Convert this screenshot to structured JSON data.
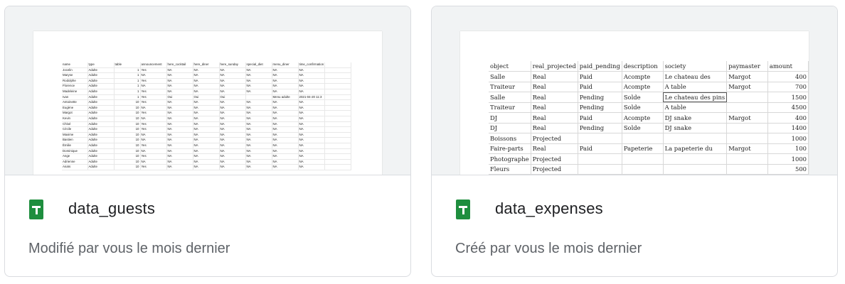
{
  "files": [
    {
      "name": "data_guests",
      "meta": "Modifié par vous le mois dernier",
      "icon": "google-sheets-icon",
      "sheet": {
        "headers": [
          "name",
          "type",
          "table",
          "announcement",
          "here_cocktail",
          "here_diner",
          "here_sunday",
          "special_diet",
          "menu_diner",
          "time_confirmation"
        ],
        "rows": [
          [
            "Jocelin",
            "Adulte",
            "1",
            "Yes",
            "NA",
            "NA",
            "NA",
            "NA",
            "NA",
            "NA"
          ],
          [
            "Maryse",
            "Adulte",
            "1",
            "NA",
            "NA",
            "NA",
            "NA",
            "NA",
            "NA",
            "NA"
          ],
          [
            "Rodolphe",
            "Adulte",
            "1",
            "Yes",
            "NA",
            "NA",
            "NA",
            "NA",
            "NA",
            "NA"
          ],
          [
            "Florence",
            "Adulte",
            "1",
            "NA",
            "NA",
            "NA",
            "NA",
            "NA",
            "NA",
            "NA"
          ],
          [
            "Madeleine",
            "Adulte",
            "1",
            "Yes",
            "NA",
            "NA",
            "NA",
            "NA",
            "NA",
            "NA"
          ],
          [
            "Ivan",
            "Adulte",
            "1",
            "Yes",
            "Oui",
            "Oui",
            "Oui",
            "",
            "Menu adulte",
            "2021-04-20 11:3"
          ],
          [
            "Antoinette",
            "Adulte",
            "10",
            "Yes",
            "NA",
            "NA",
            "NA",
            "NA",
            "NA",
            "NA"
          ],
          [
            "Eugène",
            "Adulte",
            "10",
            "NA",
            "NA",
            "NA",
            "NA",
            "NA",
            "NA",
            "NA"
          ],
          [
            "Margot",
            "Adulte",
            "10",
            "Yes",
            "NA",
            "NA",
            "NA",
            "NA",
            "NA",
            "NA"
          ],
          [
            "Kevin",
            "Adulte",
            "10",
            "NA",
            "NA",
            "NA",
            "NA",
            "NA",
            "NA",
            "NA"
          ],
          [
            "Chloé",
            "Adulte",
            "10",
            "Yes",
            "NA",
            "NA",
            "NA",
            "NA",
            "NA",
            "NA"
          ],
          [
            "Cécile",
            "Adulte",
            "10",
            "Yes",
            "NA",
            "NA",
            "NA",
            "NA",
            "NA",
            "NA"
          ],
          [
            "Maxime",
            "Adulte",
            "10",
            "NA",
            "NA",
            "NA",
            "NA",
            "NA",
            "NA",
            "NA"
          ],
          [
            "Bastien",
            "Adulte",
            "10",
            "NA",
            "NA",
            "NA",
            "NA",
            "NA",
            "NA",
            "NA"
          ],
          [
            "Émilie",
            "Adulte",
            "10",
            "Yes",
            "NA",
            "NA",
            "NA",
            "NA",
            "NA",
            "NA"
          ],
          [
            "Dominique",
            "Adulte",
            "10",
            "NA",
            "NA",
            "NA",
            "NA",
            "NA",
            "NA",
            "NA"
          ],
          [
            "Ange",
            "Adulte",
            "10",
            "Yes",
            "NA",
            "NA",
            "NA",
            "NA",
            "NA",
            "NA"
          ],
          [
            "Adrienne",
            "Adulte",
            "10",
            "NA",
            "NA",
            "NA",
            "NA",
            "NA",
            "NA",
            "NA"
          ],
          [
            "Anaïs",
            "Adulte",
            "10",
            "Yes",
            "NA",
            "NA",
            "NA",
            "NA",
            "NA",
            "NA"
          ]
        ]
      }
    },
    {
      "name": "data_expenses",
      "meta": "Créé par vous le mois dernier",
      "icon": "google-sheets-icon",
      "sheet": {
        "headers": [
          "object",
          "real_projected",
          "paid_pending",
          "description",
          "society",
          "paymaster",
          "amount"
        ],
        "rows": [
          [
            "Salle",
            "Real",
            "Paid",
            "Acompte",
            "Le chateau des",
            "Margot",
            "400"
          ],
          [
            "Traiteur",
            "Real",
            "Paid",
            "Acompte",
            "A table",
            "Margot",
            "700"
          ],
          [
            "Salle",
            "Real",
            "Pending",
            "Solde",
            "Le chateau des pins",
            "",
            "1500"
          ],
          [
            "Traiteur",
            "Real",
            "Pending",
            "Solde",
            "A table",
            "",
            "4500"
          ],
          [
            "DJ",
            "Real",
            "Paid",
            "Acompte",
            "DJ snake",
            "Margot",
            "400"
          ],
          [
            "DJ",
            "Real",
            "Pending",
            "Solde",
            "DJ snake",
            "",
            "1400"
          ],
          [
            "Boissons",
            "Projected",
            "",
            "",
            "",
            "",
            "1000"
          ],
          [
            "Faire-parts",
            "Real",
            "Paid",
            "Papeterie",
            "La papeterie du",
            "Margot",
            "100"
          ],
          [
            "Photographe",
            "Projected",
            "",
            "",
            "",
            "",
            "1000"
          ],
          [
            "Fleurs",
            "Projected",
            "",
            "",
            "",
            "",
            "500"
          ]
        ]
      }
    }
  ],
  "colors": {
    "sheets_icon": "#1e8e3e",
    "border": "#dadce0",
    "thumb_bg": "#f1f3f4"
  }
}
